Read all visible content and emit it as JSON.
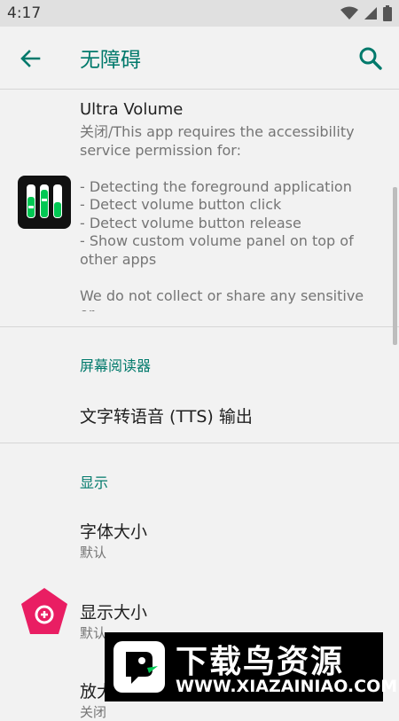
{
  "status_bar": {
    "time": "4:17",
    "icons": [
      "wifi-icon",
      "signal-icon",
      "battery-icon"
    ]
  },
  "app_bar": {
    "title": "无障碍",
    "back_icon": "arrow-back-icon",
    "search_icon": "search-icon"
  },
  "ultra_volume": {
    "title": "Ultra Volume",
    "summary": "关闭/This app requires the accessibility service permission for:\n\n- Detecting the foreground application\n- Detect volume button click\n- Detect volume button release\n- Show custom volume panel on top of other apps\n\nWe do not collect or share any sensitive or"
  },
  "screen_reader": {
    "header": "屏幕阅读器",
    "tts_title": "文字转语音 (TTS) 输出"
  },
  "display": {
    "header": "显示",
    "items": [
      {
        "title": "字体大小",
        "summary": "默认"
      },
      {
        "title": "显示大小",
        "summary": "默认"
      },
      {
        "title": "放大",
        "summary": "关闭"
      }
    ]
  },
  "watermark": {
    "title": "下载鸟资源",
    "url": "WWW.XIAZAINIAO.COM"
  },
  "colors": {
    "accent": "#00796b",
    "background": "#f2f2f2",
    "magnification_icon": "#e91e63"
  }
}
